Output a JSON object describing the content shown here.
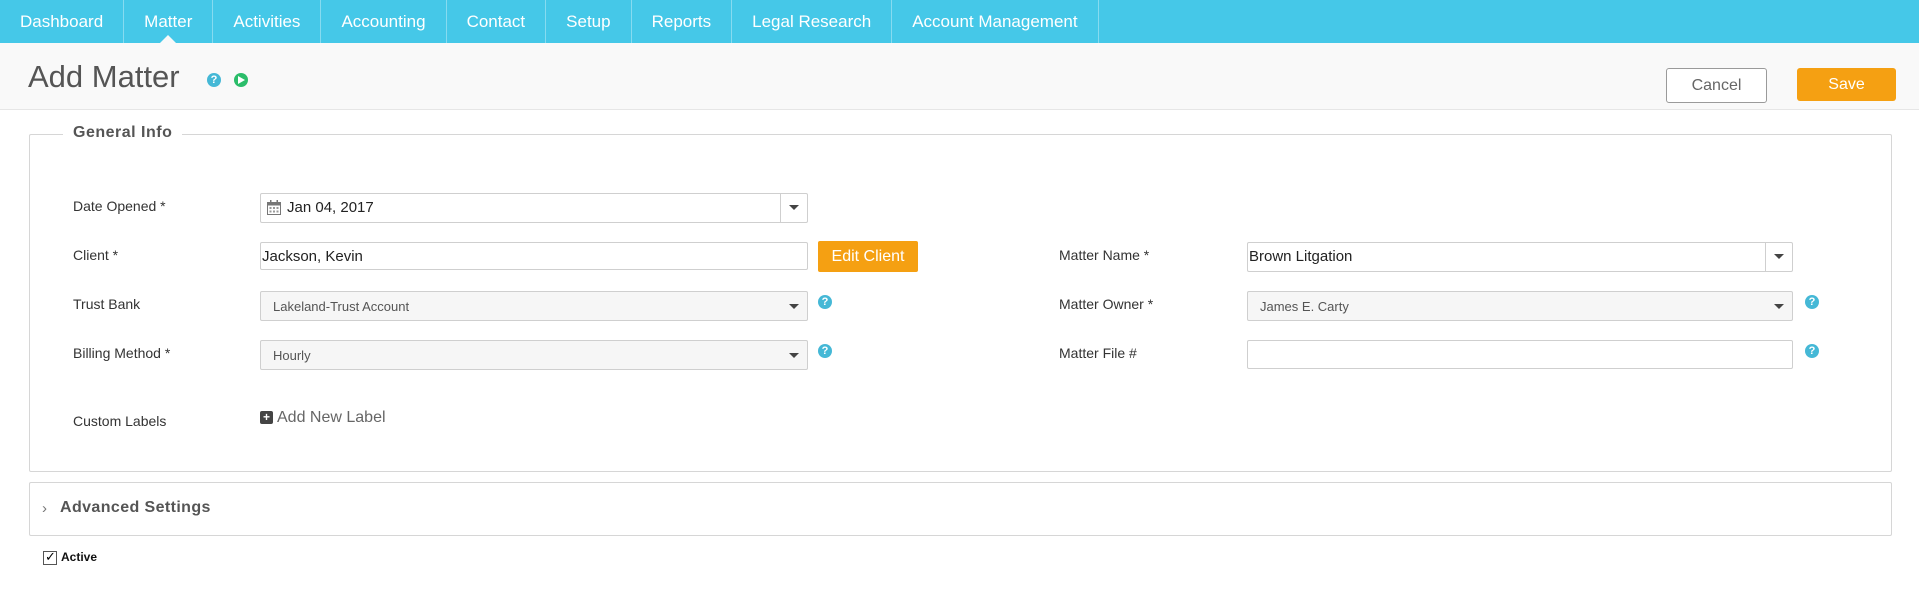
{
  "nav": {
    "items": [
      {
        "label": "Dashboard"
      },
      {
        "label": "Matter"
      },
      {
        "label": "Activities"
      },
      {
        "label": "Accounting"
      },
      {
        "label": "Contact"
      },
      {
        "label": "Setup"
      },
      {
        "label": "Reports"
      },
      {
        "label": "Legal Research"
      },
      {
        "label": "Account Management"
      }
    ],
    "active": "Matter"
  },
  "header": {
    "title": "Add Matter",
    "help_icon": "question-circle-icon",
    "play_icon": "play-circle-icon",
    "cancel_label": "Cancel",
    "save_label": "Save"
  },
  "general_info": {
    "legend": "General Info",
    "date_opened": {
      "label": "Date Opened *",
      "value": "Jan 04, 2017",
      "icon": "calendar-icon"
    },
    "client": {
      "label": "Client *",
      "value": "Jackson, Kevin",
      "edit_label": "Edit Client"
    },
    "trust_bank": {
      "label": "Trust Bank",
      "value": "Lakeland-Trust Account"
    },
    "billing_method": {
      "label": "Billing Method *",
      "value": "Hourly"
    },
    "matter_name": {
      "label": "Matter Name *",
      "value": "Brown Litgation"
    },
    "matter_owner": {
      "label": "Matter Owner *",
      "value": "James E. Carty"
    },
    "matter_file": {
      "label": "Matter File #",
      "value": ""
    },
    "custom_labels": {
      "label": "Custom Labels",
      "add_label": "Add New Label"
    }
  },
  "advanced": {
    "title": "Advanced Settings"
  },
  "active": {
    "label": "Active",
    "checked": true
  },
  "colors": {
    "nav_bg": "#45c8e8",
    "accent_orange": "#f5a012",
    "help_blue": "#45b8d6",
    "play_green": "#2bbd6a"
  }
}
